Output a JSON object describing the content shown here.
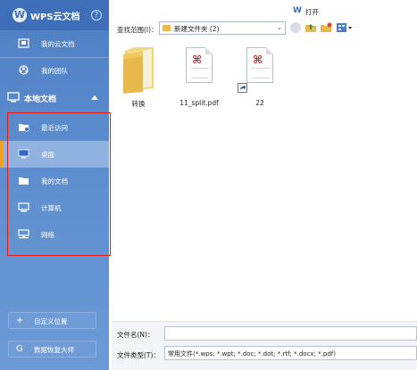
{
  "sidebar": {
    "title": "WPS云文档",
    "help": "?",
    "cloud_items": [
      {
        "label": "我的云文档"
      },
      {
        "label": "我的团队"
      }
    ],
    "local_section": {
      "label": "本地文档"
    },
    "local_items": [
      {
        "label": "最近访问"
      },
      {
        "label": "桌面"
      },
      {
        "label": "我的文档"
      },
      {
        "label": "计算机"
      },
      {
        "label": "网络"
      }
    ],
    "bottom_buttons": [
      {
        "icon": "+",
        "label": "自定义位置"
      },
      {
        "icon": "G",
        "label": "数据恢复大师"
      }
    ],
    "colors": {
      "accent": "#f0a020",
      "selected": "#8fb2e0",
      "highlight_box": "#e21b1b"
    }
  },
  "toolbar": {
    "open_label": "打开",
    "lookin_label": "查找范围(I)：",
    "lookin_value": "新建文件夹 (2)"
  },
  "files": [
    {
      "name": "转换",
      "type": "folder"
    },
    {
      "name": "11_split.pdf",
      "type": "pdf"
    },
    {
      "name": "22",
      "type": "pdf-shortcut"
    }
  ],
  "bottom": {
    "filename_label": "文件名(N)：",
    "filename_value": "",
    "filetype_label": "文件类型(T)：",
    "filetype_value": "常用文件(*.wps; *.wpt; *.doc; *.dot; *.rtf; *.docx; *.pdf)"
  }
}
